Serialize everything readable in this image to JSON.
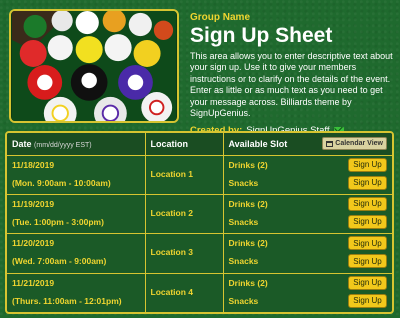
{
  "header": {
    "image": "billiard-balls-photo",
    "group_name": "Group Name",
    "title": "Sign Up Sheet",
    "description": "This area allows you to enter descriptive text about your sign up. Use it to give your members instructions or to clarify on the details of the event. Enter as little or as much text as you need to get your message across. Billiards theme by SignUpGenius.",
    "created_by_label": "Created by:",
    "created_by_name": "SignUpGenius Staff",
    "mail_icon": "mail-icon"
  },
  "table": {
    "headers": {
      "date": "Date",
      "date_format": "(mm/dd/yyyy EST)",
      "location": "Location",
      "slot": "Available Slot",
      "calendar_view": "Calendar View"
    },
    "rows": [
      {
        "date": "11/18/2019",
        "time": "(Mon. 9:00am - 10:00am)",
        "location": "Location 1",
        "slots": [
          {
            "name": "Drinks (2)",
            "button": "Sign Up"
          },
          {
            "name": "Snacks",
            "button": "Sign Up"
          }
        ]
      },
      {
        "date": "11/19/2019",
        "time": "(Tue. 1:00pm - 3:00pm)",
        "location": "Location 2",
        "slots": [
          {
            "name": "Drinks (2)",
            "button": "Sign Up"
          },
          {
            "name": "Snacks",
            "button": "Sign Up"
          }
        ]
      },
      {
        "date": "11/20/2019",
        "time": "(Wed. 7:00am - 9:00am)",
        "location": "Location 3",
        "slots": [
          {
            "name": "Drinks (2)",
            "button": "Sign Up"
          },
          {
            "name": "Snacks",
            "button": "Sign Up"
          }
        ]
      },
      {
        "date": "11/21/2019",
        "time": "(Thurs. 11:00am - 12:01pm)",
        "location": "Location 4",
        "slots": [
          {
            "name": "Drinks (2)",
            "button": "Sign Up"
          },
          {
            "name": "Snacks",
            "button": "Sign Up"
          }
        ]
      }
    ]
  },
  "colors": {
    "background": "#1f6a2e",
    "accent": "#f0d530",
    "border": "#d6c431",
    "button": "#f2c81b"
  }
}
